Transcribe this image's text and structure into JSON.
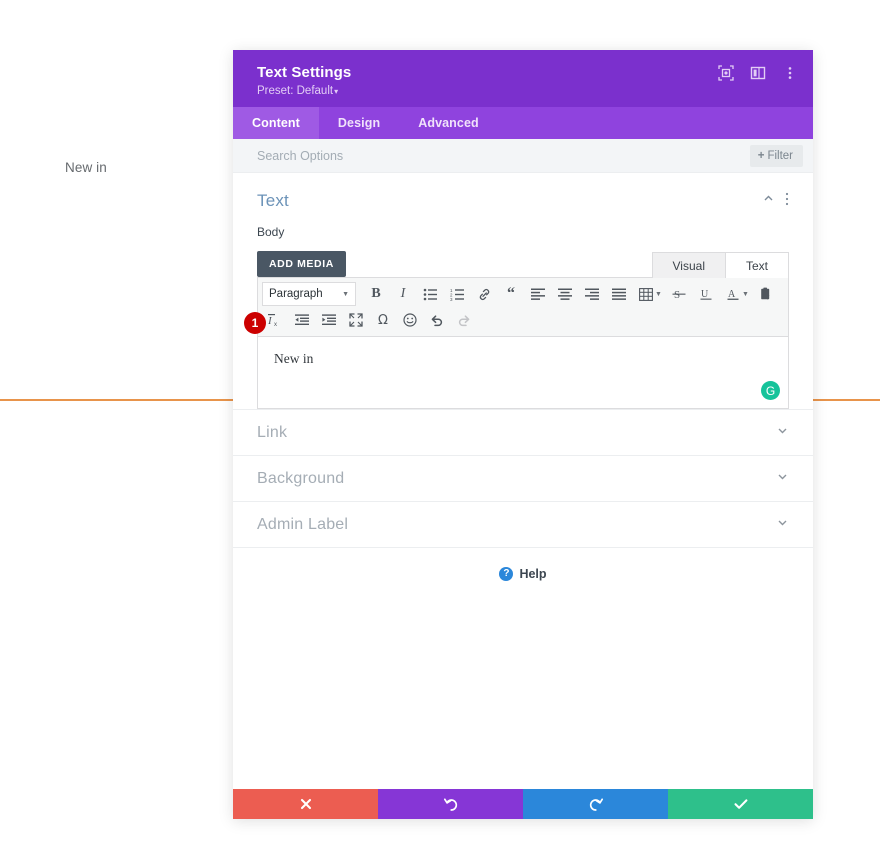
{
  "background": {
    "text": "New in",
    "rule_color": "#e8944b"
  },
  "modal": {
    "header": {
      "title": "Text Settings",
      "preset": "Preset: Default",
      "preset_caret": "▾",
      "icons": [
        {
          "name": "focus-icon",
          "label": "focus"
        },
        {
          "name": "layout-panel-icon",
          "label": "layout"
        },
        {
          "name": "more-vertical-icon",
          "label": "more"
        }
      ]
    },
    "tabs": [
      {
        "label": "Content",
        "active": true
      },
      {
        "label": "Design",
        "active": false
      },
      {
        "label": "Advanced",
        "active": false
      }
    ],
    "search": {
      "placeholder": "Search Options",
      "filter_label": "Filter",
      "filter_plus": "+"
    },
    "section": {
      "title": "Text",
      "field_label": "Body",
      "add_media_label": "ADD MEDIA",
      "editor_tabs": [
        {
          "label": "Visual",
          "active": true
        },
        {
          "label": "Text",
          "active": false
        }
      ],
      "format_select": "Paragraph",
      "editor_content": "New in",
      "grammarly_letter": "G",
      "badge": "1"
    },
    "collapsed_sections": [
      {
        "label": "Link"
      },
      {
        "label": "Background"
      },
      {
        "label": "Admin Label"
      }
    ],
    "help": {
      "label": "Help",
      "icon_glyph": "?"
    },
    "footer": [
      {
        "name": "cancel-button",
        "color": "#ec5d51",
        "icon": "close-icon"
      },
      {
        "name": "undo-button",
        "color": "#8636d6",
        "icon": "undo-icon"
      },
      {
        "name": "redo-button",
        "color": "#2b87da",
        "icon": "redo-icon"
      },
      {
        "name": "save-button",
        "color": "#2ec08b",
        "icon": "check-icon"
      }
    ]
  },
  "toolbar": {
    "row1": [
      "bold",
      "italic",
      "bulleted-list",
      "numbered-list",
      "link",
      "blockquote",
      "align-left",
      "align-center",
      "align-right",
      "align-justify",
      "table",
      "strikethrough",
      "underline",
      "text-color",
      "paste-as-text"
    ],
    "row2": [
      "clear-formatting",
      "outdent",
      "indent",
      "fullscreen",
      "special-character",
      "emoji",
      "undo",
      "redo"
    ]
  },
  "colors": {
    "header_purple": "#7b30cd",
    "tabs_purple": "#8f43de",
    "tab_active": "#9f5ae4",
    "section_title": "#6c93b8",
    "badge_red": "#cc0000",
    "grammarly_green": "#15c39a"
  }
}
